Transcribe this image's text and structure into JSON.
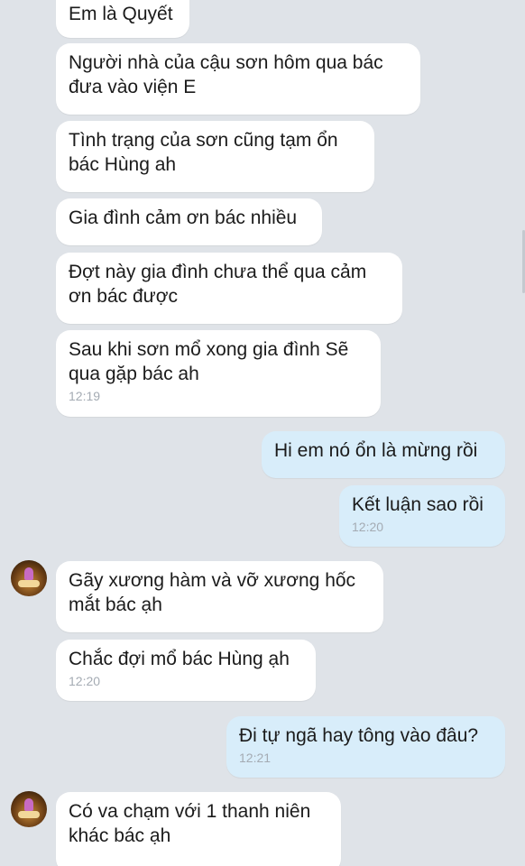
{
  "messages": [
    {
      "side": "in",
      "text": "Em là Quyết"
    },
    {
      "side": "in",
      "text": "Người nhà của cậu sơn hôm qua bác đưa vào viện E"
    },
    {
      "side": "in",
      "text": "Tình trạng của sơn cũng tạm ổn bác Hùng ah"
    },
    {
      "side": "in",
      "text": "Gia đình cảm ơn bác nhiều"
    },
    {
      "side": "in",
      "text": "Đợt này gia đình chưa thể qua cảm ơn bác được"
    },
    {
      "side": "in",
      "text": "Sau khi sơn mổ xong gia đình Sẽ qua gặp bác ah",
      "time": "12:19"
    },
    {
      "side": "out",
      "text": "Hi em nó ổn là mừng rồi"
    },
    {
      "side": "out",
      "text": "Kết luận sao rồi",
      "time": "12:20"
    },
    {
      "side": "in",
      "text": "Gãy xương hàm và vỡ xương hốc mắt bác ạh"
    },
    {
      "side": "in",
      "text": "Chắc đợi mổ bác Hùng ạh",
      "time": "12:20"
    },
    {
      "side": "out",
      "text": "Đi tự ngã hay tông vào đâu?",
      "time": "12:21"
    },
    {
      "side": "in",
      "text": "Có va chạm với 1 thanh niên khác bác ạh"
    }
  ],
  "colors": {
    "incoming_bubble": "#ffffff",
    "outgoing_bubble": "#d8edfa",
    "background": "#dfe3e8"
  },
  "icons": {
    "avatar": "contact-avatar-icon"
  }
}
